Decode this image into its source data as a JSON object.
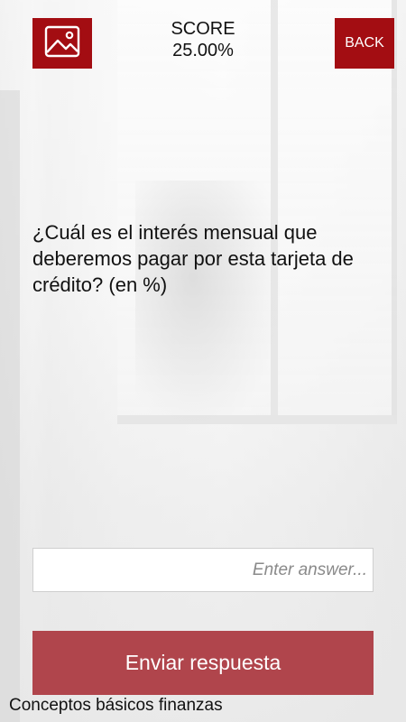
{
  "header": {
    "image_button_icon": "image-icon",
    "score_label": "SCORE",
    "score_value": "25.00%",
    "back_label": "BACK"
  },
  "question": {
    "text": "¿Cuál es el interés mensual que deberemos pagar por esta tarjeta de crédito?  (en %)"
  },
  "answer": {
    "value": "",
    "placeholder": "Enter answer..."
  },
  "submit": {
    "label": "Enviar respuesta"
  },
  "footer": {
    "category": "Conceptos básicos finanzas"
  },
  "colors": {
    "accent": "#a30d12",
    "submit": "#b0454c"
  }
}
